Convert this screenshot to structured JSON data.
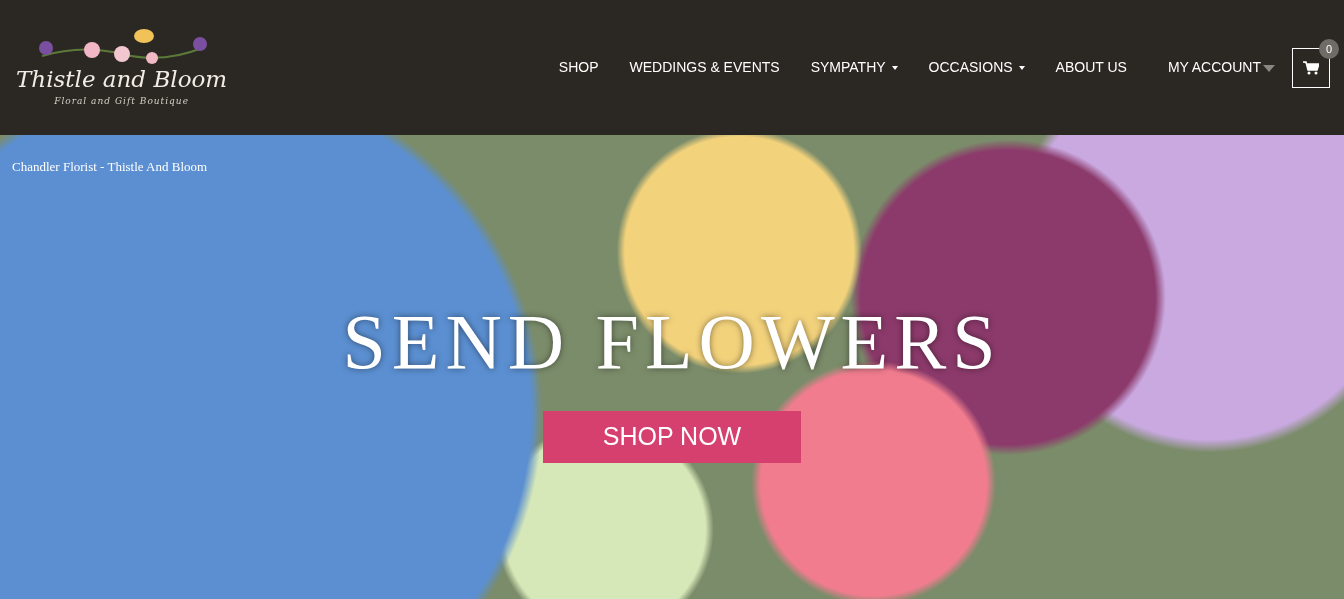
{
  "logo": {
    "title": "Thistle and Bloom",
    "tagline": "Floral and Gift Boutique"
  },
  "nav": [
    {
      "label": "SHOP",
      "dropdown": false
    },
    {
      "label": "WEDDINGS & EVENTS",
      "dropdown": false
    },
    {
      "label": "SYMPATHY",
      "dropdown": true
    },
    {
      "label": "OCCASIONS",
      "dropdown": true
    },
    {
      "label": "ABOUT US",
      "dropdown": false
    }
  ],
  "account": {
    "label": "MY ACCOUNT"
  },
  "cart": {
    "count": "0"
  },
  "hero": {
    "caption": "Chandler Florist - Thistle And Bloom",
    "headline": "SEND FLOWERS",
    "button": "SHOP NOW"
  }
}
